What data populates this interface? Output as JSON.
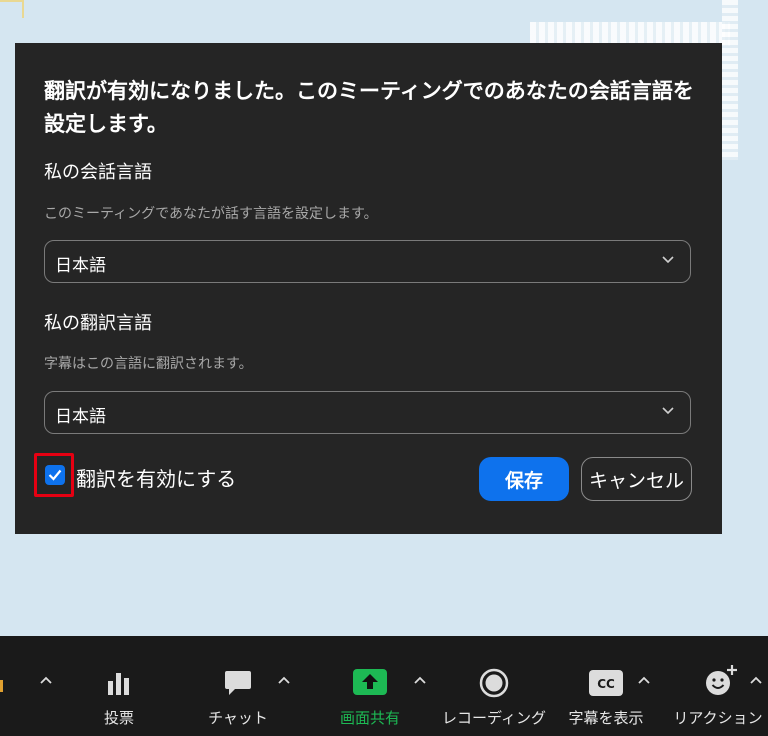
{
  "dialog": {
    "title": "翻訳が有効になりました。このミーティングでのあなたの会話言語を設定します。",
    "speaking": {
      "label": "私の会話言語",
      "description": "このミーティングであなたが話す言語を設定します。",
      "value": "日本語"
    },
    "translation": {
      "label": "私の翻訳言語",
      "description": "字幕はこの言語に翻訳されます。",
      "value": "日本語"
    },
    "enable_checkbox": {
      "label": "翻訳を有効にする",
      "checked": true
    },
    "save_label": "保存",
    "cancel_label": "キャンセル"
  },
  "toolbar": {
    "items": [
      {
        "label": "投票",
        "icon": "poll-bars-icon"
      },
      {
        "label": "チャット",
        "icon": "chat-bubble-icon"
      },
      {
        "label": "画面共有",
        "icon": "share-screen-icon",
        "color": "#1db954"
      },
      {
        "label": "レコーディング",
        "icon": "record-icon"
      },
      {
        "label": "字幕を表示",
        "icon": "cc-icon"
      },
      {
        "label": "リアクション",
        "icon": "reaction-smiley-icon"
      }
    ]
  },
  "colors": {
    "accent": "#0e72ed",
    "share_green": "#1db954",
    "highlight_red": "#e60012"
  }
}
